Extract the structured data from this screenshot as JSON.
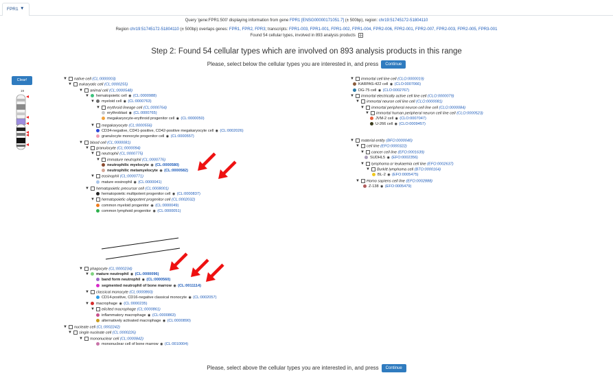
{
  "tab": {
    "label": "FPR1"
  },
  "header": {
    "line1_a": "Query 'gene:FPR1:500' displaying information from gene ",
    "line1_gene": "FPR1 [ENSG00000171051.7]",
    "line1_b": " (± 500bp), region: ",
    "line1_region": "chr19:51745172-51804110",
    "line2_a": "Region ",
    "line2_region": "chr19:51745172-51804110",
    "line2_b": " (± 500bp) overlaps genes: ",
    "line2_genes": "FPR1, FPR2, FPR3",
    "line2_c": "; transcripts: ",
    "line2_transcripts": "FPR1-003, FPR1-001, FPR1-002, FPR1-004, FPR2-006, FPR2-001, FPR2-007, FPR2-003, FPR2-005, FPR3-001",
    "line3": "Found 54 cellular types, involved in 893 analysis products"
  },
  "step_title": "Step 2: Found 54 cellular types which are involved on 893 analysis products in this range",
  "prompt_top": "Please, select below the cellular types you are interested in, and press",
  "prompt_bottom": "Please, select above the cellular types you are interested in, and press",
  "continue_label": "Continue",
  "clear_label": "Clear!",
  "chromosome_label": "19",
  "colors": {
    "accent": "#2f7bbf",
    "link": "#1a59b8",
    "arrow": "#ee1111"
  },
  "left_tree": [
    {
      "caret": true,
      "cb": true,
      "label": "native cell",
      "id": "(CL:0000003)"
    },
    {
      "caret": true,
      "cb": true,
      "label": "eukaryotic cell",
      "id": "(CL:0000255)"
    },
    {
      "caret": true,
      "cb": true,
      "label": "animal cell",
      "id": "(CL:0000548)"
    },
    {
      "caret": true,
      "dot": "#3cc27c",
      "label": "hematopoietic cell",
      "eye": true,
      "id": "(CL:0000988)"
    },
    {
      "caret": true,
      "dot": "#6b6b6b",
      "label": "myeloid cell",
      "eye": true,
      "id": "(CL:0000763)"
    },
    {
      "caret": true,
      "cb": true,
      "label": "erythroid lineage cell",
      "id": "(CL:0000764)"
    },
    {
      "dot": "#c8c8c8",
      "label": "erythroblast",
      "eye": true,
      "id": "(CL:0000765)"
    },
    {
      "dot": "#f0a23c",
      "label": "megakaryocyte-erythroid progenitor cell",
      "eye": true,
      "id": "(CL:0000050)"
    },
    {
      "caret": true,
      "cb": true,
      "label": "megakaryocyte",
      "id": "(CL:0000556)"
    },
    {
      "dot": "#2c48d8",
      "label": "CD34-negative, CD41-positive, CD42-positive megakaryocyte cell",
      "eye": true,
      "id": "(CL:0002026)"
    },
    {
      "dot": "#ef9fb4",
      "label": "granulocyte monocyte progenitor cell",
      "eye": true,
      "id": "(CL:0000557)"
    },
    {
      "caret": true,
      "cb": true,
      "label": "blood cell",
      "id": "(CL:0000081)"
    },
    {
      "caret": true,
      "cb": true,
      "label": "granulocyte",
      "id": "(CL:0000094)"
    },
    {
      "caret": true,
      "cb": true,
      "label": "neutrophil",
      "id": "(CL:0000775)"
    },
    {
      "caret": true,
      "cb": true,
      "label": "immature neutrophil",
      "id": "(CL:0000776)"
    },
    {
      "dot": "#8a4a2e",
      "label": "neutrophilic myelocyte",
      "eye": true,
      "id": "(CL:0000580)",
      "bold": true
    },
    {
      "dot": "#d4a594",
      "label": "neutrophilic metamyelocyte",
      "eye": true,
      "id": "(CL:0000582)",
      "bold": true
    },
    {
      "caret": true,
      "cb": true,
      "label": "eosinophil",
      "id": "(CL:0000771)"
    },
    {
      "dot": "#a8c4e8",
      "label": "mature eosinophil",
      "eye": true,
      "id": "(CL:0000041)"
    },
    {
      "caret": true,
      "cb": true,
      "label": "hematopoietic precursor cell",
      "id": "(CL:0008001)"
    },
    {
      "dot": "#222222",
      "label": "hematopoietic multipotent progenitor cell",
      "eye": true,
      "id": "(CL:0000837)"
    },
    {
      "caret": true,
      "cb": true,
      "label": "hematopoietic oligopotent progenitor cell",
      "id": "(CL:0002032)"
    },
    {
      "dot": "#f07c1c",
      "label": "common myeloid progenitor",
      "eye": true,
      "id": "(CL:0000049)"
    },
    {
      "dot": "#2cb04c",
      "label": "common lymphoid progenitor",
      "eye": true,
      "id": "(CL:0000051)"
    },
    {
      "caret": true,
      "cb": true,
      "label": "phagocyte",
      "id": "(CL:0000234)"
    },
    {
      "caret": true,
      "dot": "#7ed37e",
      "label": "mature neutrophil",
      "eye": true,
      "id": "(CL:0000096)",
      "bold": true
    },
    {
      "dot": "#9a68c8",
      "label": "band form neutrophil",
      "eye": true,
      "id": "(CL:0000560)",
      "bold": true
    },
    {
      "dot": "#d827c9",
      "label": "segmented neutrophil of bone marrow",
      "eye": true,
      "id": "(CL:0011114)",
      "bold": true
    },
    {
      "caret": true,
      "cb": true,
      "label": "classical monocyte",
      "id": "(CL:0000860)"
    },
    {
      "dot": "#2c9ce6",
      "label": "CD14-positive, CD16-negative classical monocyte",
      "eye": true,
      "id": "(CL:0002057)"
    },
    {
      "caret": true,
      "dot": "#d62c2c",
      "label": "macrophage",
      "eye": true,
      "id": "(CL:0000235)"
    },
    {
      "caret": true,
      "cb": true,
      "label": "elicited macrophage",
      "id": "(CL:0000861)"
    },
    {
      "dot": "#c8508c",
      "label": "inflammatory macrophage",
      "eye": true,
      "id": "(CL:0000863)"
    },
    {
      "dot": "#c89c1c",
      "label": "alternatively activated macrophage",
      "eye": true,
      "id": "(CL:0000890)"
    },
    {
      "caret": true,
      "cb": true,
      "label": "nucleate cell",
      "id": "(CL:0002242)"
    },
    {
      "caret": true,
      "cb": true,
      "label": "single nucleate cell",
      "id": "(CL:0000226)"
    },
    {
      "caret": true,
      "cb": true,
      "label": "mononuclear cell",
      "id": "(CL:0000842)"
    },
    {
      "dot": "#c874a8",
      "label": "mononuclear cell of bone marrow",
      "eye": true,
      "id": "(CL:0010004)"
    }
  ],
  "right_tree": [
    {
      "caret": true,
      "cb": true,
      "label": "immortal cell line cell",
      "id": "(CLO:0000019)"
    },
    {
      "dot": "#8a5c3c",
      "label": "KARPAS-422 cell",
      "eye": true,
      "id": "(CLO:0007066)"
    },
    {
      "dot": "#2c7ca8",
      "label": "DG-75 cell",
      "eye": true,
      "id": "(CLO:0002767)"
    },
    {
      "caret": true,
      "cb": true,
      "label": "immortal electrically active cell line cell",
      "id": "(CLO:0000079)"
    },
    {
      "caret": true,
      "cb": true,
      "label": "immortal neuron cell line cell",
      "id": "(CLO:0000081)"
    },
    {
      "caret": true,
      "cb": true,
      "label": "immortal peripheral neuron cell line cell",
      "id": "(CLO:0000084)"
    },
    {
      "caret": true,
      "cb": true,
      "label": "immortal human peripheral neuron cell line cell",
      "id": "(CLO:0000523)"
    },
    {
      "dot": "#e8603c",
      "label": "JVM-2 cell",
      "eye": true,
      "id": "(CLO:0007047)"
    },
    {
      "dot": "#3c3c1c",
      "label": "U-266 cell",
      "eye": true,
      "id": "(CLO:0009457)"
    },
    {
      "caret": true,
      "cb": true,
      "label": "material entity",
      "id": "(BFO:0000040)"
    },
    {
      "caret": true,
      "cb": true,
      "label": "cell line",
      "id": "(EFO:0000322)"
    },
    {
      "caret": true,
      "cb": true,
      "label": "cancer cell line",
      "id": "(EFO:0001639)"
    },
    {
      "dot": "#a89cb8",
      "label": "SUDHL5",
      "eye": true,
      "id": "(EFO:0002356)"
    },
    {
      "caret": true,
      "cb": true,
      "label": "lymphoma or leukaemia cell line",
      "id": "(EFO:0002637)"
    },
    {
      "caret": true,
      "cb": true,
      "label": "Burkitt lymphoma cell",
      "id": "(BTO:0000164)"
    },
    {
      "dot": "#f0c81c",
      "label": "BL-2",
      "eye": true,
      "id": "(EFO:0005475)"
    },
    {
      "caret": true,
      "cb": true,
      "label": "Homo sapiens cell line",
      "id": "(EFO:0002888)"
    },
    {
      "dot": "#b05c5c",
      "label": "Z-138",
      "eye": true,
      "id": "(EFO:0005479)"
    }
  ]
}
